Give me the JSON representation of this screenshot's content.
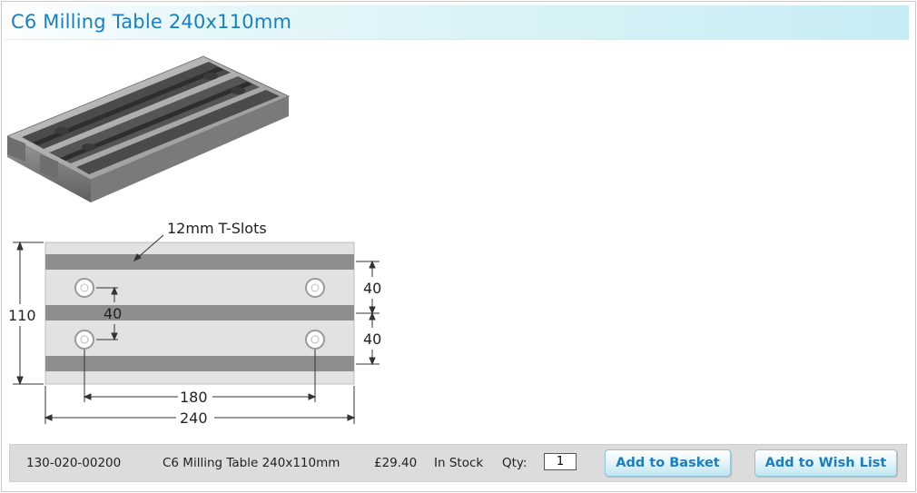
{
  "page": {
    "title": "C6 Milling Table 240x110mm"
  },
  "drawing": {
    "slot_label": "12mm T-Slots",
    "dim_height": "110",
    "dim_hole_spacing_inner": "40",
    "dim_right_top": "40",
    "dim_right_bottom": "40",
    "dim_hole_spacing_length": "180",
    "dim_total_length": "240"
  },
  "product": {
    "code": "130-020-00200",
    "name": "C6 Milling Table 240x110mm",
    "price": "£29.40",
    "stock": "In Stock",
    "qty_label": "Qty:",
    "qty_value": "1",
    "add_basket": "Add to Basket",
    "add_wishlist": "Add to Wish List"
  },
  "colors": {
    "title_text": "#1780c4",
    "title_bar": "#c6ecf3",
    "button_text": "#1a7fc2",
    "product_bar": "#dcdcdc"
  }
}
